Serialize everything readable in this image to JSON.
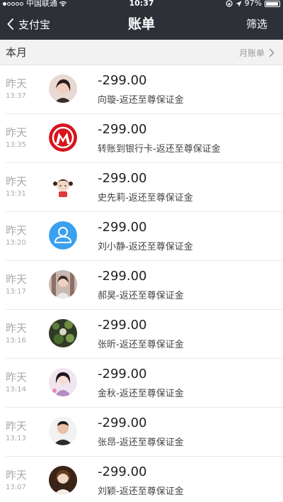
{
  "status_bar": {
    "carrier": "中国联通",
    "time": "10:37",
    "battery": "97%"
  },
  "nav": {
    "back_label": "支付宝",
    "title": "账单",
    "filter_label": "筛选"
  },
  "section": {
    "title": "本月",
    "monthly_bill_label": "月账单"
  },
  "transactions": [
    {
      "day": "昨天",
      "time": "13:37",
      "amount": "-299.00",
      "description": "向璇-返还至尊保证金",
      "avatar": "photo-avatar"
    },
    {
      "day": "昨天",
      "time": "13:35",
      "amount": "-299.00",
      "description": "转账到银行卡-返还至尊保证金",
      "avatar": "bank-logo"
    },
    {
      "day": "昨天",
      "time": "13:31",
      "amount": "-299.00",
      "description": "史先莉-返还至尊保证金",
      "avatar": "cartoon-avatar"
    },
    {
      "day": "昨天",
      "time": "13:20",
      "amount": "-299.00",
      "description": "刘小静-返还至尊保证金",
      "avatar": "default-user-avatar"
    },
    {
      "day": "昨天",
      "time": "13:17",
      "amount": "-299.00",
      "description": "郝昊-返还至尊保证金",
      "avatar": "photo-avatar"
    },
    {
      "day": "昨天",
      "time": "13:16",
      "amount": "-299.00",
      "description": "张昕-返还至尊保证金",
      "avatar": "photo-avatar"
    },
    {
      "day": "昨天",
      "time": "13:14",
      "amount": "-299.00",
      "description": "金秋-返还至尊保证金",
      "avatar": "photo-avatar"
    },
    {
      "day": "昨天",
      "time": "13:13",
      "amount": "-299.00",
      "description": "张昂-返还至尊保证金",
      "avatar": "photo-avatar"
    },
    {
      "day": "昨天",
      "time": "13:07",
      "amount": "-299.00",
      "description": "刘颖-返还至尊保证金",
      "avatar": "photo-avatar"
    }
  ],
  "colors": {
    "nav_background": "#2e3038",
    "section_background": "#f2f2f2",
    "bank_red": "#d7141e",
    "default_avatar_blue": "#3aa0ef"
  }
}
